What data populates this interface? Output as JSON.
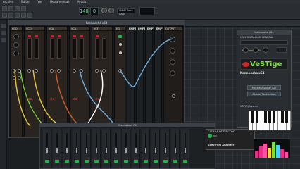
{
  "menubar": {
    "items": [
      "Archivo",
      "Editar",
      "Ver",
      "Herramientas",
      "Ayuda"
    ]
  },
  "toolbar": {
    "tempo": "140",
    "position": "0",
    "info": "LMMS Rack Rack"
  },
  "rack": {
    "title": "Kannoosha x64",
    "modules": [
      {
        "label": "VCO",
        "tag": "01"
      },
      {
        "label": "VCO",
        "tag": "02"
      },
      {
        "label": "VCA",
        "tag": "01"
      },
      {
        "label": "VCA",
        "tag": "02"
      },
      {
        "label": "VCF",
        "tag": "03"
      },
      {
        "label": "EG",
        "tag": "02"
      }
    ],
    "empty_label": "EMPTY",
    "empty_count": 4,
    "last_module": "OUTPUT"
  },
  "mixer": {
    "title": "Mezcladora FX",
    "channel_count": 15,
    "fx_title": "CADENA DE EFECTOS",
    "fx_item": "Spectrum Analyzer",
    "fx_power": "ON"
  },
  "plugin": {
    "title": "Kannoosha x64",
    "section": "CONFIGURACIÓN GENERAL",
    "instrument": "Kannoosha x64",
    "logo": "VeSTige",
    "plugin_name": "Kannoosha x64",
    "open_button": "Mostrar/Ocultar GUI",
    "params_button": "Ajustar Parámetros",
    "status_label": "VST(R) Vaxum"
  },
  "colors": {
    "accent": "#7ee03a",
    "panel": "#2a2e32",
    "background": "#1c1f22"
  }
}
